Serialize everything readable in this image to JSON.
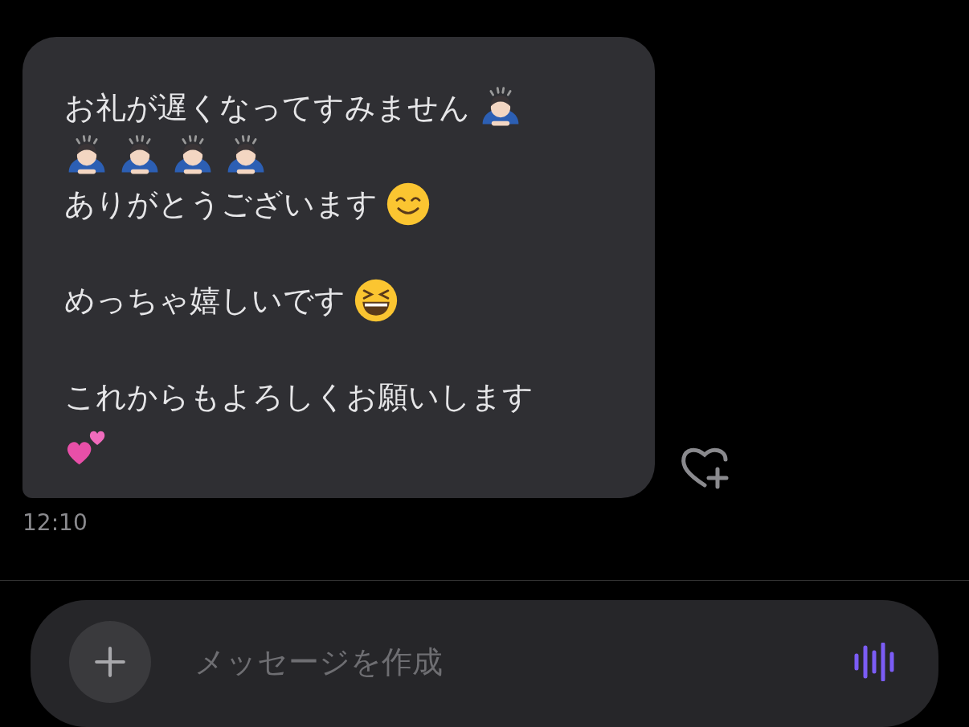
{
  "message": {
    "paragraphs": [
      {
        "lines": [
          {
            "segments": [
              {
                "kind": "text",
                "text": "お礼が遅くなってすみません"
              },
              {
                "kind": "bowing"
              }
            ]
          },
          {
            "segments": [
              {
                "kind": "bowing"
              },
              {
                "kind": "bowing"
              },
              {
                "kind": "bowing"
              },
              {
                "kind": "bowing"
              }
            ]
          },
          {
            "segments": [
              {
                "kind": "text",
                "text": "ありがとうございます"
              },
              {
                "kind": "smiling"
              }
            ]
          }
        ]
      },
      {
        "lines": [
          {
            "segments": [
              {
                "kind": "text",
                "text": "めっちゃ嬉しいです"
              },
              {
                "kind": "laughing"
              }
            ]
          }
        ]
      },
      {
        "lines": [
          {
            "segments": [
              {
                "kind": "text",
                "text": "これからもよろしくお願いします"
              }
            ]
          },
          {
            "segments": [
              {
                "kind": "hearts"
              }
            ]
          }
        ]
      }
    ],
    "time": "12:10"
  },
  "composer": {
    "placeholder": "メッセージを作成"
  }
}
